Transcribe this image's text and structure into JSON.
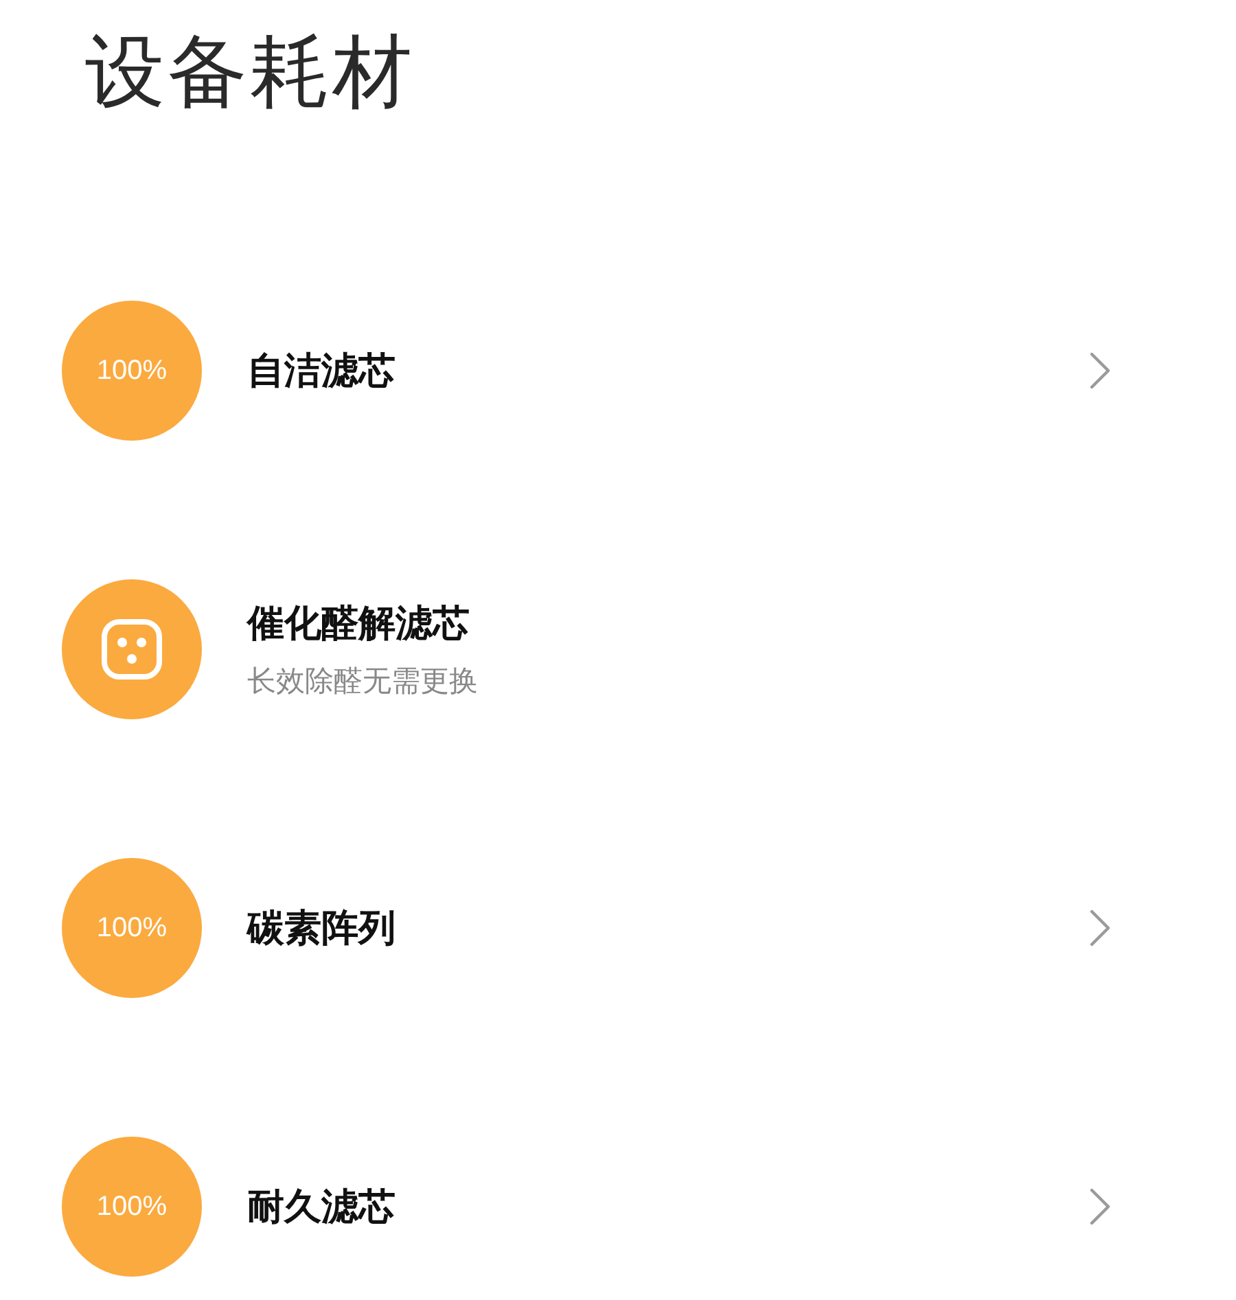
{
  "title": "设备耗材",
  "items": [
    {
      "kind": "percent",
      "badge": "100%",
      "name": "自洁滤芯",
      "chevron": true
    },
    {
      "kind": "icon",
      "name": "催化醛解滤芯",
      "subtitle": "长效除醛无需更换",
      "chevron": false
    },
    {
      "kind": "percent",
      "badge": "100%",
      "name": "碳素阵列",
      "chevron": true
    },
    {
      "kind": "percent",
      "badge": "100%",
      "name": "耐久滤芯",
      "chevron": true
    }
  ]
}
